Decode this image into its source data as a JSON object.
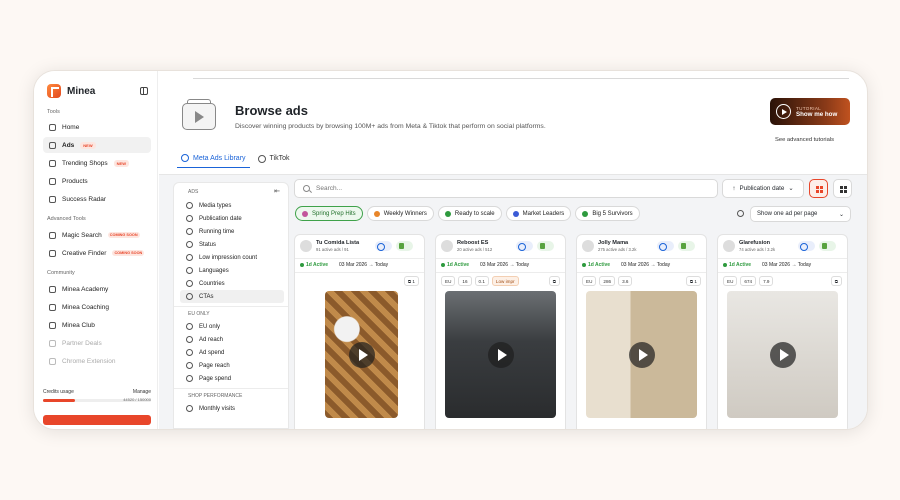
{
  "app": {
    "name": "Minea"
  },
  "sidebar": {
    "sections": [
      {
        "title": "Tools"
      },
      {
        "title": "Advanced Tools"
      },
      {
        "title": "Community"
      }
    ],
    "items": [
      {
        "label": "Home",
        "icon": "home-icon"
      },
      {
        "label": "Ads",
        "icon": "ads-icon",
        "badge": "NEW",
        "active": true
      },
      {
        "label": "Trending Shops",
        "icon": "shop-icon",
        "badge": "NEW"
      },
      {
        "label": "Products",
        "icon": "box-icon"
      },
      {
        "label": "Success Radar",
        "icon": "radar-icon"
      },
      {
        "label": "Magic Search",
        "icon": "magic-icon",
        "badge": "COMING SOON"
      },
      {
        "label": "Creative Finder",
        "icon": "creative-icon",
        "badge": "COMING SOON"
      },
      {
        "label": "Minea Academy",
        "icon": "academy-icon"
      },
      {
        "label": "Minea Coaching",
        "icon": "coaching-icon"
      },
      {
        "label": "Minea Club",
        "icon": "club-icon"
      },
      {
        "label": "Partner Deals",
        "icon": "deals-icon"
      },
      {
        "label": "Chrome Extension",
        "icon": "chrome-icon"
      }
    ],
    "credits": {
      "label": "Credits usage",
      "manage": "Manage",
      "value": "44520 / 150000",
      "fraction": 0.3
    }
  },
  "header": {
    "title": "Browse ads",
    "subtitle": "Discover winning products by browsing 100M+ ads from Meta & Tiktok that perform on social platforms.",
    "tutorial_kicker": "TUTORIAL",
    "tutorial_label": "Show me how",
    "advanced_link": "See advanced tutorials"
  },
  "tabs": [
    {
      "label": "Meta Ads Library",
      "active": true
    },
    {
      "label": "TikTok"
    }
  ],
  "filters": {
    "groups": [
      {
        "title": "ADS",
        "items": [
          "Media types",
          "Publication date",
          "Running time",
          "Status",
          "Low impression count",
          "Languages",
          "Countries",
          "CTAs"
        ]
      },
      {
        "title": "EU ONLY",
        "items": [
          "EU only",
          "Ad reach",
          "Ad spend",
          "Page reach",
          "Page spend"
        ]
      },
      {
        "title": "SHOP PERFORMANCE",
        "items": [
          "Monthly visits"
        ]
      }
    ]
  },
  "toolbar": {
    "search_placeholder": "Search...",
    "sort_label": "Publication date",
    "show_one_label": "Show one ad per page"
  },
  "chips": [
    {
      "label": "Spring Prep Hits",
      "active": true,
      "color": "#c2569b"
    },
    {
      "label": "Weekly Winners",
      "color": "#e8862a"
    },
    {
      "label": "Ready to scale",
      "color": "#2e9a3e"
    },
    {
      "label": "Market Leaders",
      "color": "#3b5bd6"
    },
    {
      "label": "Big 5 Survivors",
      "color": "#2e9a3e"
    }
  ],
  "cards": [
    {
      "name": "Tu Comida Lista",
      "meta": "91 active ads / 91",
      "status": "1d Active",
      "date": "03 Mar 2026 → Today",
      "stats": [],
      "copies": "1",
      "media": "food"
    },
    {
      "name": "Reboost ES",
      "meta": "20 active ads / 512",
      "status": "1d Active",
      "date": "03 Mar 2026 → Today",
      "stats": [
        "EU",
        "16",
        "0.1",
        "Low impr"
      ],
      "copies": "",
      "media": "person"
    },
    {
      "name": "Jolly Mama",
      "meta": "275 active ads / 3.2k",
      "status": "1d Active",
      "date": "03 Mar 2026 → Today",
      "stats": [
        "EU",
        "286",
        "3.6"
      ],
      "copies": "1",
      "media": "room"
    },
    {
      "name": "Glarefusion",
      "meta": "74 active ads / 3.2k",
      "status": "1d Active",
      "date": "03 Mar 2026 → Today",
      "stats": [
        "EU",
        "674",
        "7.9"
      ],
      "copies": "",
      "media": "lamp"
    }
  ]
}
